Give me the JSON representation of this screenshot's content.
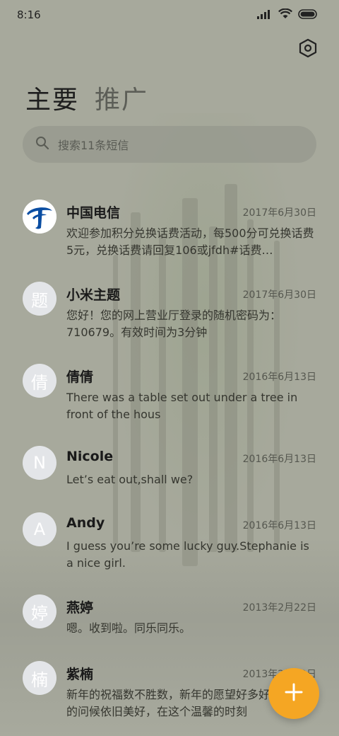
{
  "status_bar": {
    "time": "8:16",
    "icons": [
      "signal-icon",
      "wifi-icon",
      "battery-icon"
    ]
  },
  "header": {
    "settings_icon": "settings-hexagon-icon",
    "tabs": [
      {
        "label": "主要",
        "active": true
      },
      {
        "label": "推广",
        "active": false
      }
    ]
  },
  "search": {
    "placeholder": "搜索11条短信",
    "icon": "search-icon"
  },
  "messages": [
    {
      "avatar": "telecom-logo",
      "name": "中国电信",
      "date": "2017年6月30日",
      "preview": "欢迎参加积分兑换话费活动，每500分可兑换话费5元，兑换话费请回复106或jfdh#话费…"
    },
    {
      "avatar": "题",
      "name": "小米主题",
      "date": "2017年6月30日",
      "preview": "您好！您的网上营业厅登录的随机密码为：710679。有效时间为3分钟"
    },
    {
      "avatar": "倩",
      "name": "倩倩",
      "date": "2016年6月13日",
      "preview": "There was a table set out under a tree in front of the hous"
    },
    {
      "avatar": "N",
      "name": "Nicole",
      "date": "2016年6月13日",
      "preview": "Let’s eat out,shall we?"
    },
    {
      "avatar": "A",
      "name": "Andy",
      "date": "2016年6月13日",
      "preview": "I guess you’re some lucky guy.Stephanie is a nice girl."
    },
    {
      "avatar": "婷",
      "name": "燕婷",
      "date": "2013年2月22日",
      "preview": "嗯。收到啦。同乐同乐。"
    },
    {
      "avatar": "楠",
      "name": "紫楠",
      "date": "2013年2月22日",
      "preview": "新年的祝福数不胜数，新年的愿望好多好多，新年的问候依旧美好，在这个温馨的时刻"
    }
  ],
  "fab": {
    "icon": "plus-icon",
    "color": "#f5a623"
  },
  "colors": {
    "accent": "#f5a623",
    "telecom_blue": "#0a4da2",
    "avatar_bg": "#e3e5e8"
  }
}
